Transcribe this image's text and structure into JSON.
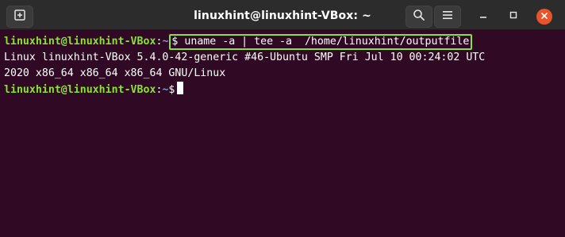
{
  "window": {
    "title": "linuxhint@linuxhint-VBox: ~",
    "icons": {
      "new_tab": "new-tab-icon",
      "search": "search-icon",
      "menu": "hamburger-menu-icon",
      "minimize": "minimize-icon",
      "maximize": "maximize-icon",
      "close": "close-icon"
    }
  },
  "terminal": {
    "prompt_user": "linuxhint@linuxhint-VBox",
    "prompt_sep": ":",
    "prompt_path": "~",
    "prompt_symbol": "$",
    "command": "$ uname -a | tee -a  /home/linuxhint/outputfile",
    "output": [
      "Linux linuxhint-VBox 5.4.0-42-generic #46-Ubuntu SMP Fri Jul 10 00:24:02 UTC",
      "2020 x86_64 x86_64 x86_64 GNU/Linux"
    ]
  },
  "colors": {
    "terminal_bg": "#300a24",
    "prompt_user": "#8ae234",
    "prompt_path": "#729fcf",
    "highlight_box": "#8ae234",
    "close_button": "#e9542a",
    "titlebar_bg": "#2c2c2c"
  }
}
